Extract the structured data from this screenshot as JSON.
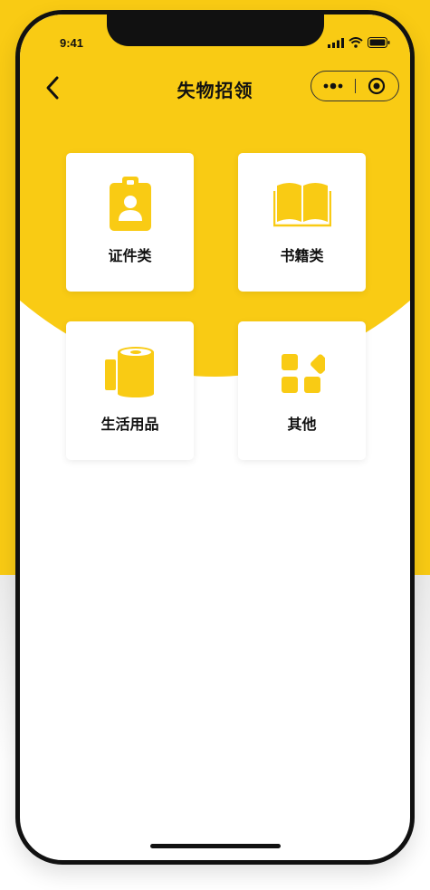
{
  "status_bar": {
    "time": "9:41"
  },
  "nav": {
    "title": "失物招领"
  },
  "categories": [
    {
      "label": "证件类",
      "icon": "id-badge-icon"
    },
    {
      "label": "书籍类",
      "icon": "book-icon"
    },
    {
      "label": "生活用品",
      "icon": "tissue-roll-icon"
    },
    {
      "label": "其他",
      "icon": "apps-grid-icon"
    }
  ],
  "colors": {
    "accent": "#F9CB14",
    "text": "#111111",
    "card": "#FFFFFF"
  }
}
